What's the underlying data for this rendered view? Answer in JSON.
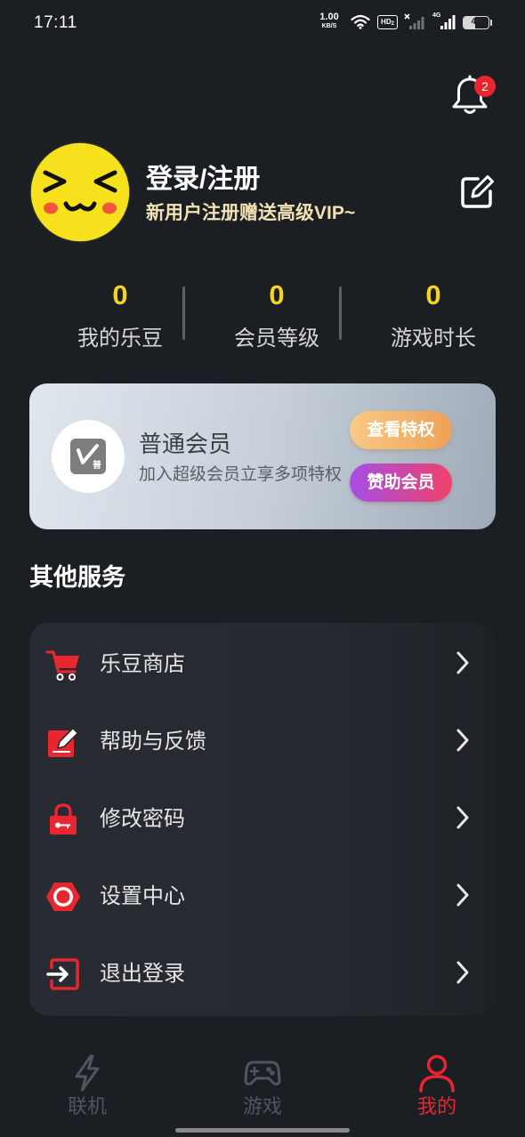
{
  "status_bar": {
    "time": "17:11",
    "net_speed_value": "1.00",
    "net_speed_unit": "KB/S",
    "hd_label": "HD",
    "hd_sub": "2",
    "network_type": "4G",
    "battery_level": "45"
  },
  "header": {
    "notification_icon": "bell-icon",
    "notification_count": "2"
  },
  "profile": {
    "avatar": "smiley-face-avatar",
    "title": "登录/注册",
    "subtitle": "新用户注册赠送高级VIP~",
    "edit_icon": "edit-icon"
  },
  "stats": [
    {
      "value": "0",
      "label": "我的乐豆"
    },
    {
      "value": "0",
      "label": "会员等级"
    },
    {
      "value": "0",
      "label": "游戏时长"
    }
  ],
  "membership": {
    "badge_char": "普",
    "title": "普通会员",
    "subtitle": "加入超级会员立享多项特权",
    "view_privileges_button": "查看特权",
    "sponsor_button": "赞助会员"
  },
  "services": {
    "title": "其他服务",
    "items": [
      {
        "label": "乐豆商店",
        "icon": "shopping-cart-icon"
      },
      {
        "label": "帮助与反馈",
        "icon": "feedback-edit-icon"
      },
      {
        "label": "修改密码",
        "icon": "lock-icon"
      },
      {
        "label": "设置中心",
        "icon": "settings-icon"
      },
      {
        "label": "退出登录",
        "icon": "logout-icon"
      }
    ]
  },
  "bottom_nav": [
    {
      "label": "联机",
      "icon": "lightning-icon",
      "active": false
    },
    {
      "label": "游戏",
      "icon": "gamepad-icon",
      "active": false
    },
    {
      "label": "我的",
      "icon": "person-icon",
      "active": true
    }
  ],
  "colors": {
    "background": "#1b1e23",
    "accent_red": "#e8262f",
    "stat_yellow": "#f6d31f",
    "subtitle_cream": "#f2e2b3",
    "inactive_nav": "#50565e"
  }
}
